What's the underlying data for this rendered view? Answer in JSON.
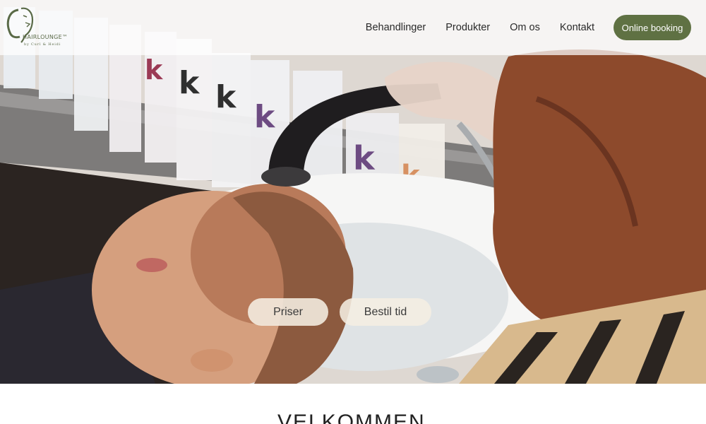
{
  "logo": {
    "brand": "HAIRLOUNGE™",
    "tagline": "by Curl & Heidi"
  },
  "nav": {
    "items": [
      "Behandlinger",
      "Produkter",
      "Om os",
      "Kontakt"
    ],
    "booking_label": "Online booking"
  },
  "hero": {
    "cta_prices": "Priser",
    "cta_book": "Bestil tid"
  },
  "welcome": {
    "heading": "VELKOMMEN"
  },
  "colors": {
    "accent": "#5f7143",
    "cta_bg": "#f5eee2"
  }
}
